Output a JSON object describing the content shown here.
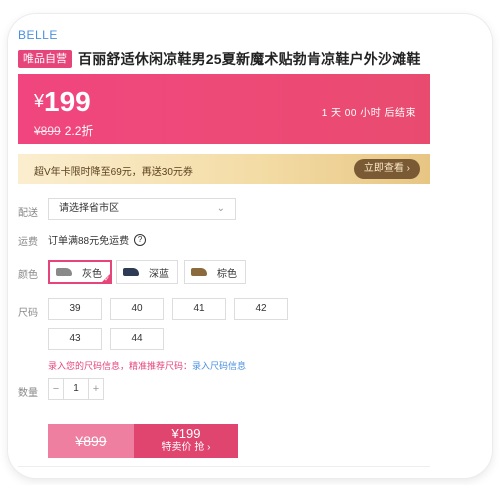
{
  "brand": "BELLE",
  "product": {
    "badge": "唯品自营",
    "title": "百丽舒适休闲凉鞋男25夏新魔术贴勃肯凉鞋户外沙滩鞋"
  },
  "price": {
    "currency": "¥",
    "current": "199",
    "original": "¥899",
    "discount": "2.2折",
    "countdown": "1 天 00 小时 后结束"
  },
  "vip": {
    "promo": "超V年卡限时降至69元，再送30元券",
    "button": "立即查看 ›"
  },
  "delivery": {
    "label": "配送",
    "placeholder": "请选择省市区",
    "chevron_icon": "chevron-down-icon"
  },
  "shipping": {
    "label": "运费",
    "text": "订单满88元免运费",
    "help_icon": "?"
  },
  "colors": {
    "label": "颜色",
    "options": [
      {
        "name": "灰色",
        "selected": true,
        "swatch": "#8a8a8a"
      },
      {
        "name": "深蓝",
        "selected": false,
        "swatch": "#2e3b55"
      },
      {
        "name": "棕色",
        "selected": false,
        "swatch": "#8b6a3e"
      }
    ]
  },
  "sizes": {
    "label": "尺码",
    "options": [
      "39",
      "40",
      "41",
      "42",
      "43",
      "44"
    ],
    "tip": "录入您的尺码信息，精准推荐尺码：",
    "tip_link": "录入尺码信息"
  },
  "quantity": {
    "label": "数量",
    "minus": "−",
    "value": "1",
    "plus": "+"
  },
  "buy": {
    "original": "¥899",
    "price": "¥199",
    "action": "特卖价 抢 ›"
  },
  "colors_theme": {
    "accent": "#e6457a",
    "banner": "#ee4a78",
    "vip_gold": "#f3dba4",
    "link": "#4a90e2"
  }
}
